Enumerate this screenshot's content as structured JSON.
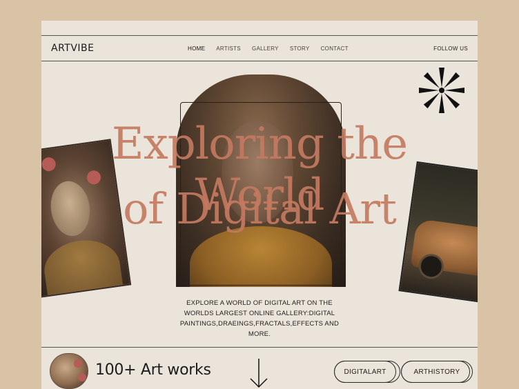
{
  "nav": {
    "logo": "ARTVIBE",
    "items": [
      "HOME",
      "ARTISTS",
      "GALLERY",
      "STORY",
      "CONTACT"
    ],
    "active": "HOME",
    "follow": "FOLLOW US"
  },
  "hero": {
    "title_line1": "Exploring the World",
    "title_line2": "of Digital Art",
    "description": "EXPLORE A WORLD OF DIGITAL ART ON THE WORLDS LARGEST ONLINE GALLERY:DIGITAL PAINTINGS,DRAEINGS,FRACTALS,EFFECTS AND MORE."
  },
  "footer": {
    "count": "100+ Art works",
    "tags": [
      "DIGITALART",
      "ARTHISTORY"
    ]
  },
  "colors": {
    "background": "#d8c3a7",
    "page": "#ebe4da",
    "title": "#c47a61"
  },
  "icons": [
    "asterisk-icon",
    "arrow-down-icon"
  ]
}
